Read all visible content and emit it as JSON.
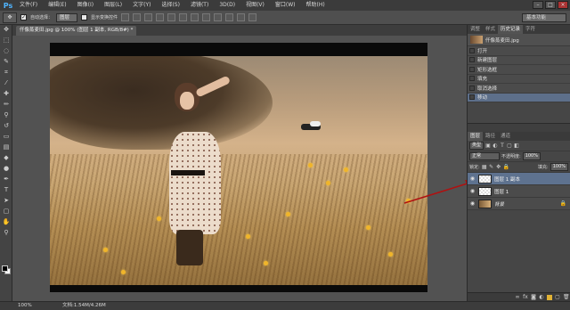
{
  "menu": {
    "items": [
      "文件(F)",
      "编辑(E)",
      "图像(I)",
      "图层(L)",
      "文字(Y)",
      "选择(S)",
      "滤镜(T)",
      "3D(D)",
      "视图(V)",
      "窗口(W)",
      "帮助(H)"
    ],
    "logo": "Ps"
  },
  "options": {
    "auto_select_label": "自动选择：",
    "auto_select_value": "图层",
    "show_transform_label": "显示变换控件",
    "workspace": "基本功能"
  },
  "document": {
    "tab_title": "仟像蒸麦田.jpg @ 100% (图层 1 副本, RGB/8#) *"
  },
  "status": {
    "zoom": "100%",
    "doc_size": "文档:1.54M/4.26M"
  },
  "history": {
    "tabs": [
      "调整",
      "样式",
      "历史记录",
      "字符"
    ],
    "snapshot_name": "仟像蒸麦田.jpg",
    "steps": [
      "打开",
      "新建图层",
      "矩形选框",
      "填充",
      "取消选择",
      "移动"
    ],
    "active_step_index": 5
  },
  "layers": {
    "tabs": [
      "图层",
      "路径",
      "通道"
    ],
    "filter_kind": "类型",
    "blend_mode": "正常",
    "opacity_label": "不透明度:",
    "opacity_value": "100%",
    "lock_label": "锁定:",
    "fill_label": "填充:",
    "fill_value": "100%",
    "rows": [
      {
        "name": "图层 1 副本",
        "active": true
      },
      {
        "name": "图层 1",
        "active": false
      },
      {
        "name": "背景",
        "active": false,
        "locked": true
      }
    ]
  },
  "colors": {
    "accent_arrow": "#b01010",
    "selection": "#5e728f"
  }
}
